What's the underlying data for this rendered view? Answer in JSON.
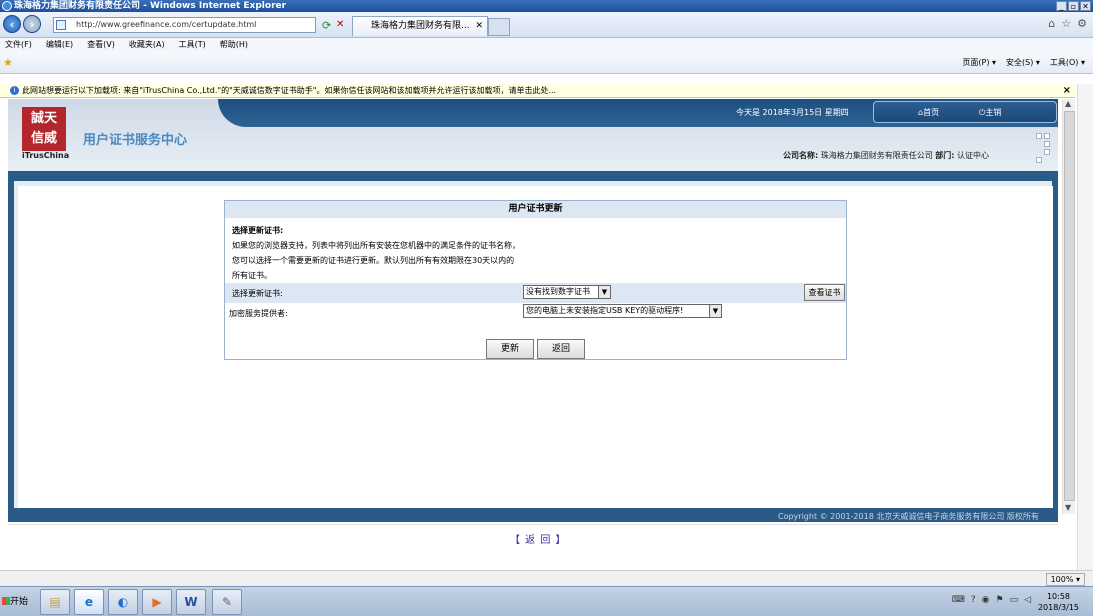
{
  "browser": {
    "window_title": "珠海格力集团财务有限责任公司 - Windows Internet Explorer",
    "address_url": "http://www.greefinance.com/certupdate.html",
    "tab_title": "珠海格力集团财务有限...",
    "tab_close": "✕",
    "menu": [
      "文件(F)",
      "编辑(E)",
      "查看(V)",
      "收藏夹(A)",
      "工具(T)",
      "帮助(H)"
    ],
    "command_bar": [
      "页面(P) ▾",
      "安全(S) ▾",
      "工具(O) ▾"
    ],
    "infobar_text": "此网站想要运行以下加载项: 来自\"iTrusChina Co.,Ltd.\"的\"天威诚信数字证书助手\"。如果你信任该网站和该加载项并允许运行该加载项，请单击此处...",
    "status_zoom": "100% ▾"
  },
  "header": {
    "logo_text_line1": "誠天",
    "logo_text_line2": "信威",
    "logo_en": "iTrusChina",
    "site_title": "用户证书服务中心",
    "today": "今天是 2018年3月15日 星期四",
    "home_label": "首页",
    "logout_label": "主销",
    "company_label": "公司名称:",
    "company_name": "珠海格力集团财务有限责任公司",
    "dept_label": "部门:",
    "dept_name": "认证中心"
  },
  "form": {
    "title": "用户证书更新",
    "section_title": "选择更新证书:",
    "desc_lines": [
      "如果您的浏览器支持，列表中将列出所有安装在您机器中的满足条件的证书名称，",
      "您可以选择一个需要更新的证书进行更新。默认列出所有有效期限在30天以内的",
      "所有证书。"
    ],
    "cert_label": "选择更新证书:",
    "cert_value": "没有找到数字证书",
    "view_cert_button": "查看证书",
    "provider_label": "加密服务提供者:",
    "provider_value": "您的电脑上未安装指定USB KEY的驱动程序!",
    "update_button": "更新",
    "back_button": "返回"
  },
  "footer": {
    "copyright": "Copyright © 2001-2018 北京天威诚信电子商务服务有限公司 版权所有",
    "back_link": "【 返 回 】"
  },
  "taskbar": {
    "start_label": "开始",
    "clock_time": "10:58",
    "clock_date": "2018/3/15"
  }
}
